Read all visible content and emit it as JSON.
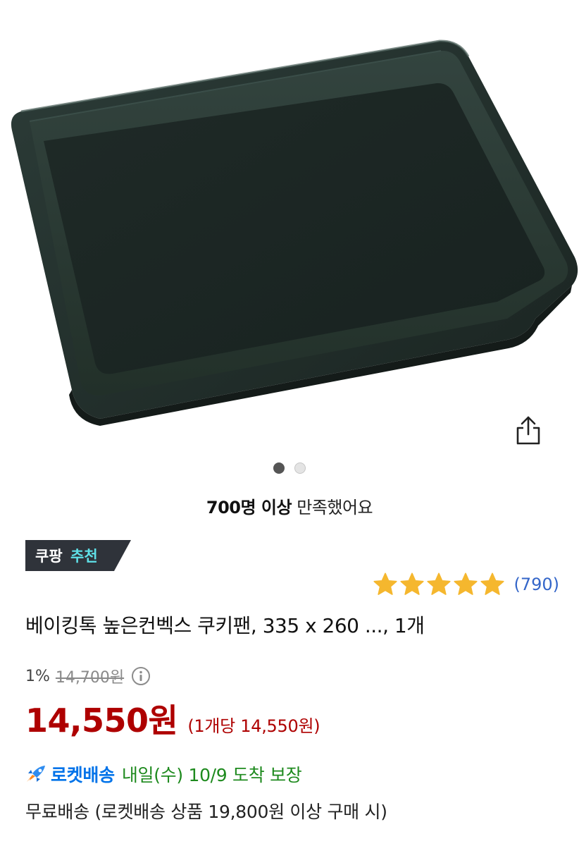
{
  "product": {
    "title": "베이킹톡 높은컨벡스 쿠키팬, 335 x 260 ..., 1개",
    "image_alt": "dark rectangular baking tray"
  },
  "carousel": {
    "pages": 2,
    "active_index": 0
  },
  "satisfaction": {
    "strong": "700명 이상",
    "text": "만족했어요"
  },
  "badge": {
    "part1": "쿠팡",
    "part2": "추천"
  },
  "rating": {
    "stars": 5,
    "review_count": "(790)"
  },
  "pricing": {
    "discount_rate": "1%",
    "original_price": "14,700원",
    "price": "14,550원",
    "unit_price": "(1개당 14,550원)"
  },
  "delivery": {
    "rocket_label": "로켓배송",
    "arrival": "내일(수) 10/9 도착 보장",
    "shipping": "무료배송 (로켓배송 상품 19,800원 이상 구매 시)"
  },
  "icons": {
    "share": "share-icon",
    "info": "info-icon",
    "rocket": "rocket-icon",
    "star": "star-icon"
  },
  "colors": {
    "price": "#ae0000",
    "rocket": "#0073e9",
    "arrival": "#1e8a1e",
    "review_link": "#3466c9",
    "star": "#f5b72e",
    "badge_bg": "#2f333a",
    "badge_accent": "#5fe1e8"
  }
}
